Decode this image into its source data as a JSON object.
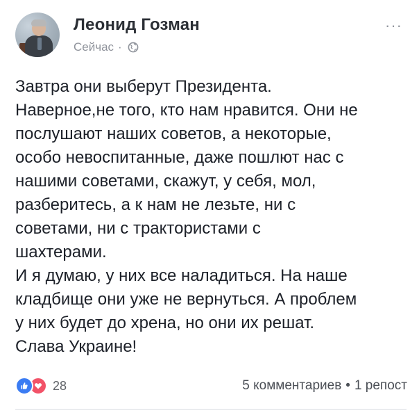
{
  "post": {
    "author": "Леонид Гозман",
    "time": "Сейчас",
    "meta_separator": "·",
    "privacy_icon": "globe-icon",
    "more_icon": "ellipsis-icon",
    "more_label": "···",
    "text_lines": [
      "Завтра они выберут Президента.",
      "Наверное,не того, кто нам нравится. Они не",
      "послушают наших советов, а некоторые,",
      "особо невоспитанные, даже пошлют нас с",
      "нашими советами, скажут, у себя, мол,",
      "разберитесь, а к нам не лезьте, ни с",
      "советами, ни с трактористами с",
      "шахтерами.",
      "И я думаю, у них все наладиться. На наше",
      "кладбище они уже не вернуться. А проблем",
      "у них будет до хрена, но они их решат.",
      "Слава Украине!"
    ],
    "reactions": {
      "icons": [
        "like-icon",
        "love-icon"
      ],
      "count": "28"
    },
    "comments": "5 комментариев",
    "stats_separator": "•",
    "shares": "1 репост"
  },
  "colors": {
    "text": "#1d2129",
    "meta": "#90949c",
    "like": "#3b7cf3",
    "love": "#f25268"
  }
}
